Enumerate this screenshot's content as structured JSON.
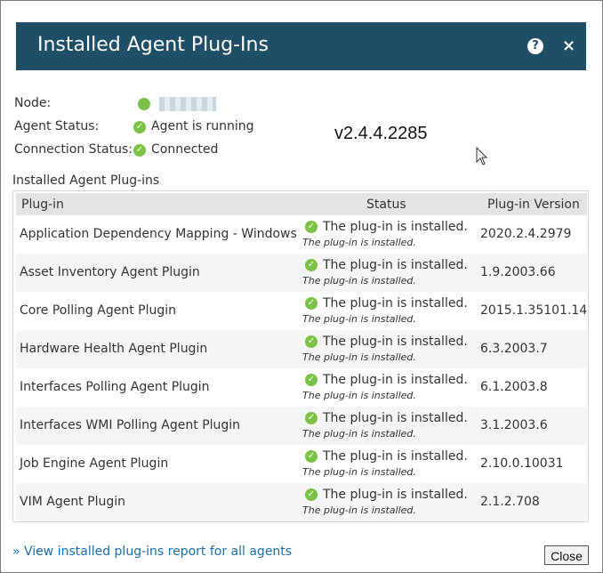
{
  "dialog": {
    "title": "Installed Agent Plug-Ins",
    "help_icon_glyph": "?",
    "close_glyph": "×"
  },
  "info": {
    "node_label": "Node:",
    "agent_status_label": "Agent Status:",
    "agent_status_value": "Agent is running",
    "connection_status_label": "Connection Status:",
    "connection_status_value": "Connected",
    "version": "v2.4.4.2285"
  },
  "section_label": "Installed Agent Plug-ins",
  "table": {
    "headers": {
      "plugin": "Plug-in",
      "status": "Status",
      "version": "Plug-in Version"
    },
    "rows": [
      {
        "name": "Application Dependency Mapping - Windows",
        "status": "The plug-in is installed.",
        "status_sub": "The plug-in is installed.",
        "version": "2020.2.4.2979"
      },
      {
        "name": "Asset Inventory Agent Plugin",
        "status": "The plug-in is installed.",
        "status_sub": "The plug-in is installed.",
        "version": "1.9.2003.66"
      },
      {
        "name": "Core Polling Agent Plugin",
        "status": "The plug-in is installed.",
        "status_sub": "The plug-in is installed.",
        "version": "2015.1.35101.14"
      },
      {
        "name": "Hardware Health Agent Plugin",
        "status": "The plug-in is installed.",
        "status_sub": "The plug-in is installed.",
        "version": "6.3.2003.7"
      },
      {
        "name": "Interfaces Polling Agent Plugin",
        "status": "The plug-in is installed.",
        "status_sub": "The plug-in is installed.",
        "version": "6.1.2003.8"
      },
      {
        "name": "Interfaces WMI Polling Agent Plugin",
        "status": "The plug-in is installed.",
        "status_sub": "The plug-in is installed.",
        "version": "3.1.2003.6"
      },
      {
        "name": "Job Engine Agent Plugin",
        "status": "The plug-in is installed.",
        "status_sub": "The plug-in is installed.",
        "version": "2.10.0.10031"
      },
      {
        "name": "VIM Agent Plugin",
        "status": "The plug-in is installed.",
        "status_sub": "The plug-in is installed.",
        "version": "2.1.2.708"
      }
    ]
  },
  "footer": {
    "report_link": "» View installed plug-ins report for all agents",
    "close_label": "Close"
  },
  "colors": {
    "title_bar": "#1f4f66",
    "success_green": "#7cc247",
    "link_blue": "#1b6ea8"
  },
  "icons": {
    "help": "help-icon",
    "close": "close-icon",
    "status": "check-circle-icon",
    "node_status": "status-dot-icon"
  }
}
